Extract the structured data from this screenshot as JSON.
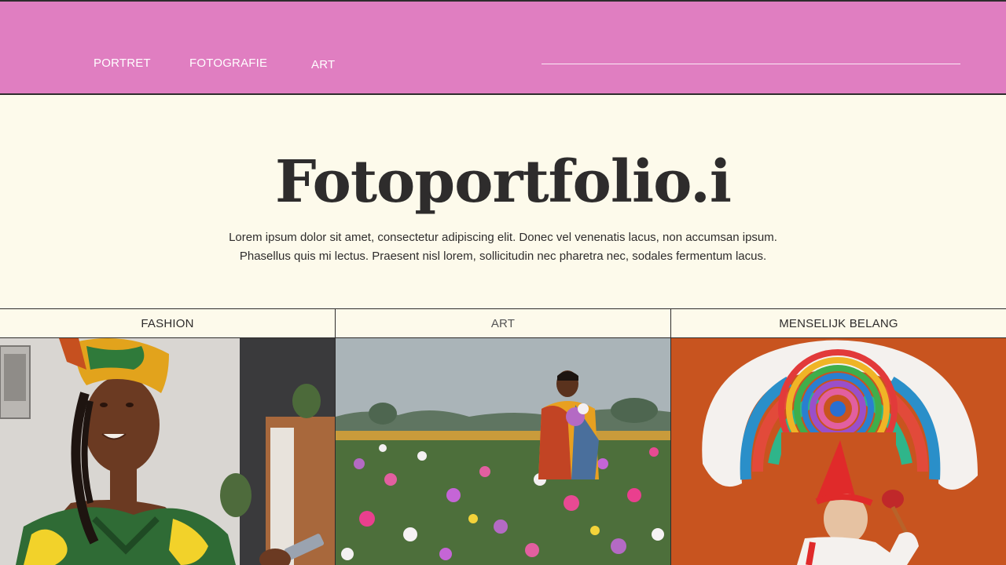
{
  "nav": {
    "items": [
      {
        "label": "PORTRET"
      },
      {
        "label": "FOTOGRAFIE"
      },
      {
        "label": "ART"
      }
    ]
  },
  "hero": {
    "title": "Fotoportfolio.i",
    "subtitle_line1": "Lorem ipsum dolor sit amet, consectetur adipiscing elit. Donec vel venenatis lacus, non accumsan ipsum.",
    "subtitle_line2": "Phasellus quis mi lectus. Praesent nisl lorem, sollicitudin nec pharetra nec, sodales fermentum lacus."
  },
  "categories": [
    {
      "label": "FASHION"
    },
    {
      "label": "ART"
    },
    {
      "label": "MENSELIJK BELANG"
    }
  ],
  "colors": {
    "header_bg": "#e07ec1",
    "page_bg": "#fdfaeb",
    "text": "#2e2c2c"
  },
  "photos": [
    {
      "subject": "woman-in-headwrap-portrait"
    },
    {
      "subject": "woman-in-flower-field"
    },
    {
      "subject": "dancer-with-colorful-fan-headdress"
    }
  ]
}
